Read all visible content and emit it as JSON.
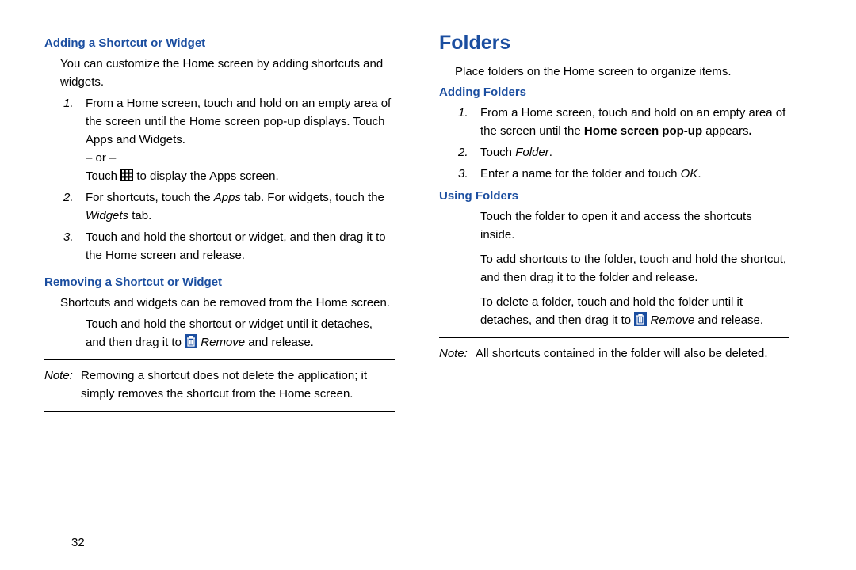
{
  "page_number": "32",
  "left": {
    "h_adding": "Adding a Shortcut or Widget",
    "adding_intro": "You can customize the Home screen by adding shortcuts and widgets.",
    "step1_a": "From a Home screen, touch and hold on an empty area of the screen until the Home screen pop-up displays. Touch Apps and Widgets.",
    "or": "– or –",
    "step1_b_pre": "Touch ",
    "step1_b_post": " to display the Apps screen.",
    "step2_pre": "For shortcuts, touch the ",
    "step2_apps": "Apps",
    "step2_mid": " tab. For widgets, touch the ",
    "step2_widgets": "Widgets",
    "step2_post": " tab.",
    "step3": "Touch and hold the shortcut or widget, and then drag it to the Home screen and release.",
    "h_removing": "Removing a Shortcut or Widget",
    "removing_intro": "Shortcuts and widgets can be removed from the Home screen.",
    "removing_body_pre": "Touch and hold the shortcut or widget until it detaches, and then drag it to ",
    "remove_word": "Remove",
    "removing_body_post": " and release.",
    "note_label": "Note:",
    "note_body": "Removing a shortcut does not delete the application; it simply removes the shortcut from the Home screen."
  },
  "right": {
    "h_section": "Folders",
    "intro": "Place folders on the Home screen to organize items.",
    "h_adding_folders": "Adding Folders",
    "step1_pre": "From a Home screen, touch and hold on an empty area of the screen until the ",
    "step1_bold": "Home screen pop-up",
    "step1_post_bold": " appears",
    "step1_period": ".",
    "step2_touch": "Touch ",
    "step2_folder": "Folder",
    "step2_period": ".",
    "step3_pre": "Enter a name for the folder and touch ",
    "step3_ok": "OK",
    "step3_period": ".",
    "h_using_folders": "Using Folders",
    "use_p1": "Touch the folder to open it and access the shortcuts inside.",
    "use_p2": "To add shortcuts to the folder, touch and hold the shortcut, and then drag it to the folder and release.",
    "use_p3_pre": "To delete a folder, touch and hold the folder until it detaches, and then drag it to ",
    "remove_word": "Remove",
    "use_p3_post": " and release.",
    "note_label": "Note:",
    "note_body": "All shortcuts contained in the folder will also be deleted."
  }
}
